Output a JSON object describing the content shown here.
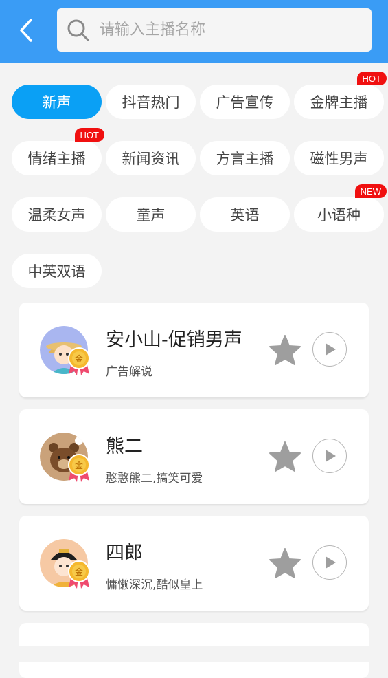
{
  "header": {
    "back_icon": "chevron-left-icon",
    "search": {
      "placeholder": "请输入主播名称",
      "value": "",
      "icon": "search-icon"
    },
    "bg_color": "#3a9cf5"
  },
  "tags": [
    {
      "label": "新声",
      "active": true
    },
    {
      "label": "抖音热门"
    },
    {
      "label": "广告宣传"
    },
    {
      "label": "金牌主播",
      "badge": "HOT"
    },
    {
      "label": "情绪主播",
      "badge": "HOT"
    },
    {
      "label": "新闻资讯"
    },
    {
      "label": "方言主播"
    },
    {
      "label": "磁性男声"
    },
    {
      "label": "温柔女声"
    },
    {
      "label": "童声"
    },
    {
      "label": "英语"
    },
    {
      "label": "小语种",
      "badge": "NEW"
    },
    {
      "label": "中英双语"
    }
  ],
  "anchors": [
    {
      "name": "安小山-促销男声",
      "desc": "广告解说",
      "medal": "金",
      "avatar": "boy-avatar"
    },
    {
      "name": "熊二",
      "desc": "憨憨熊二,搞笑可爱",
      "medal": "金",
      "avatar": "bear-avatar"
    },
    {
      "name": "四郎",
      "desc": "慵懒深沉,酷似皇上",
      "medal": "金",
      "avatar": "emperor-avatar"
    }
  ],
  "colors": {
    "accent": "#0aa0f5",
    "badge": "#f01010",
    "star": "#9e9e9e"
  }
}
